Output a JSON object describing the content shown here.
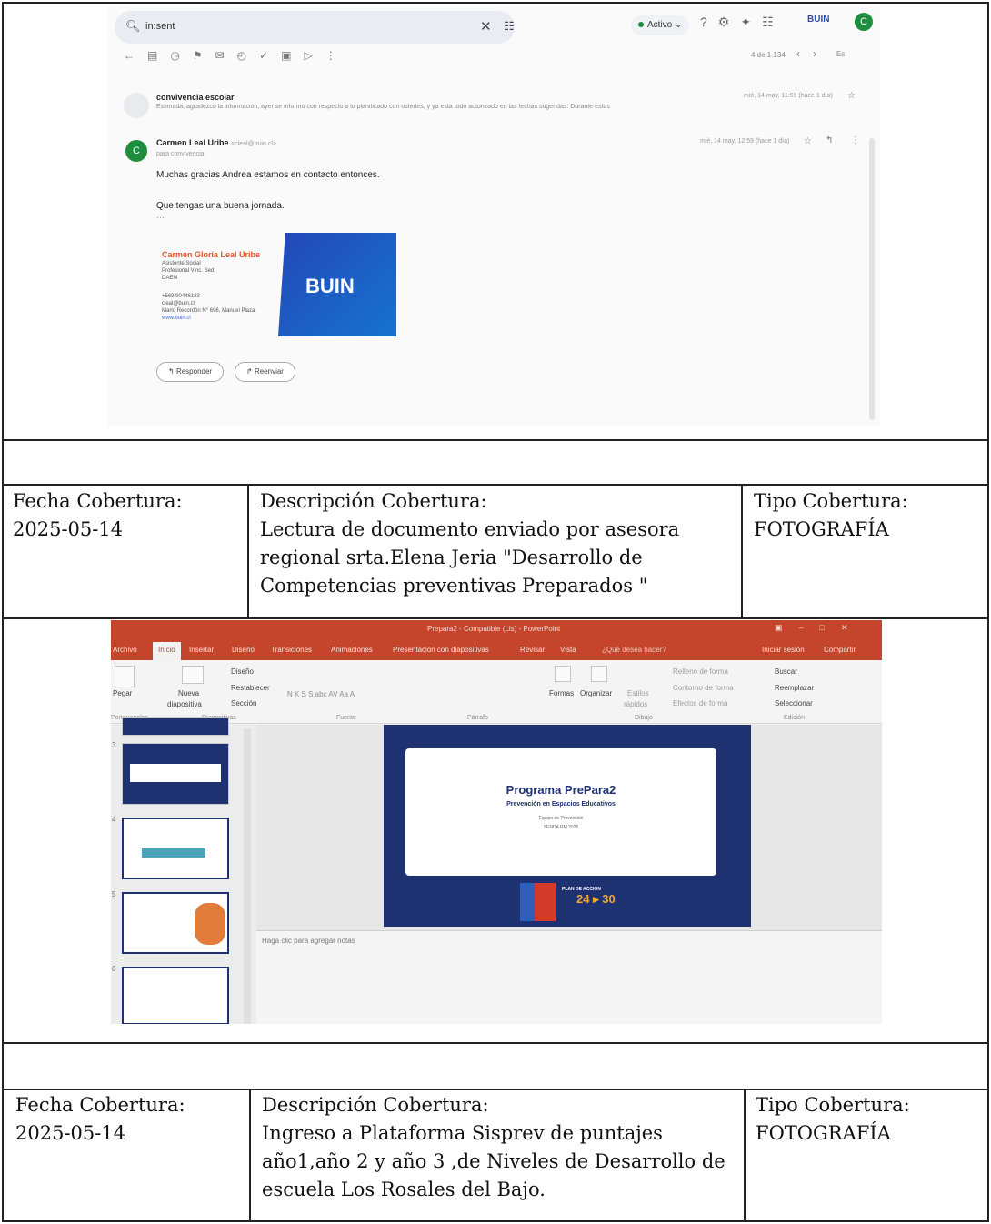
{
  "gmail": {
    "search_text": "in:sent",
    "status_label": "Activo",
    "brand_label": "BUIN",
    "avatar_letter": "C",
    "message_count": "4 de 1.134",
    "language_label": "Es",
    "thread1": {
      "sender": "convivencia escolar",
      "snippet": "Estimada, agradezco la información, ayer se informó con respecto a lo planificado con ustedes, y ya está todo autorizado en las fechas sugeridas. Durante estos",
      "date": "mié, 14 may, 11:59 (hace 1 día)"
    },
    "thread2": {
      "avatar_letter": "C",
      "sender": "Carmen Leal Uribe",
      "sender_email": "<cleal@buin.cl>",
      "to": "para convivencia",
      "date": "mié, 14 may, 12:59 (hace 1 día)",
      "body_line1": "Muchas gracias Andrea estamos en contacto entonces.",
      "body_line2": "Que tengas una buena jornada.",
      "ellipsis": "···"
    },
    "signature": {
      "name": "Carmen Gloria Leal Uribe",
      "role1": "Asistente Social",
      "role2": "Profesional Vinc. Sed",
      "role3": "DAEM",
      "phone": "+569 90446183",
      "email": "cleal@buin.cl",
      "address": "Mario Recordón N° 696, Manuel Plaza",
      "web": "www.buin.cl",
      "logo_text": "BUIN"
    },
    "reply_label": "Responder",
    "forward_label": "Reenviar"
  },
  "row1": {
    "date_label": "Fecha Cobertura:",
    "date_value": "2025-05-14",
    "desc_label": "Descripción Cobertura:",
    "desc_lines": [
      "Lectura de documento enviado por asesora",
      "regional srta.Elena Jeria \"Desarrollo de",
      "Competencias preventivas Preparados \""
    ],
    "type_label": "Tipo Cobertura:",
    "type_value": "FOTOGRAFÍA"
  },
  "ppt": {
    "window_title": "Prepara2 - Compatible (Lis) - PowerPoint",
    "tabs": [
      "Archivo",
      "Inicio",
      "Insertar",
      "Diseño",
      "Transiciones",
      "Animaciones",
      "Presentación con diapositivas",
      "Revisar",
      "Vista",
      "¿Qué desea hacer?"
    ],
    "signin": "Iniciar sesión",
    "share": "Compartir",
    "ribbon": {
      "paste": "Pegar",
      "new_slide_1": "Nueva",
      "new_slide_2": "diapositiva",
      "layout": "Diseño",
      "reset": "Restablecer",
      "section": "Sección",
      "font_style": "N K S S abc AV Aa A",
      "shapes": "Formas",
      "arrange": "Organizar",
      "quick_styles_1": "Estilos",
      "quick_styles_2": "rápidos",
      "fill": "Relleno de forma",
      "outline": "Contorno de forma",
      "effects": "Efectos de forma",
      "find": "Buscar",
      "replace": "Reemplazar",
      "select": "Seleccionar",
      "group_clipboard": "Portapapeles",
      "group_slides": "Diapositivas",
      "group_font": "Fuente",
      "group_paragraph": "Párrafo",
      "group_drawing": "Dibujo",
      "group_editing": "Edición"
    },
    "thumb_numbers": [
      "3",
      "4",
      "5",
      "6"
    ],
    "slide": {
      "title": "Programa PrePara2",
      "subtitle": "Prevención en Espacios Educativos",
      "line3": "Equipo de Prevención",
      "line4": "SENDA RM 2025",
      "plan_label": "PLAN DE ACCIÓN",
      "plan_years": "24 ▸ 30"
    },
    "notes_placeholder": "Haga clic para agregar notas"
  },
  "row2": {
    "date_label": "Fecha Cobertura:",
    "date_value": "2025-05-14",
    "desc_label": "Descripción Cobertura:",
    "desc_lines": [
      "Ingreso a Plataforma Sisprev de puntajes",
      "año1,año 2 y año 3 ,de Niveles de Desarrollo de",
      "escuela Los Rosales del Bajo."
    ],
    "type_label": "Tipo Cobertura:",
    "type_value": "FOTOGRAFÍA"
  }
}
